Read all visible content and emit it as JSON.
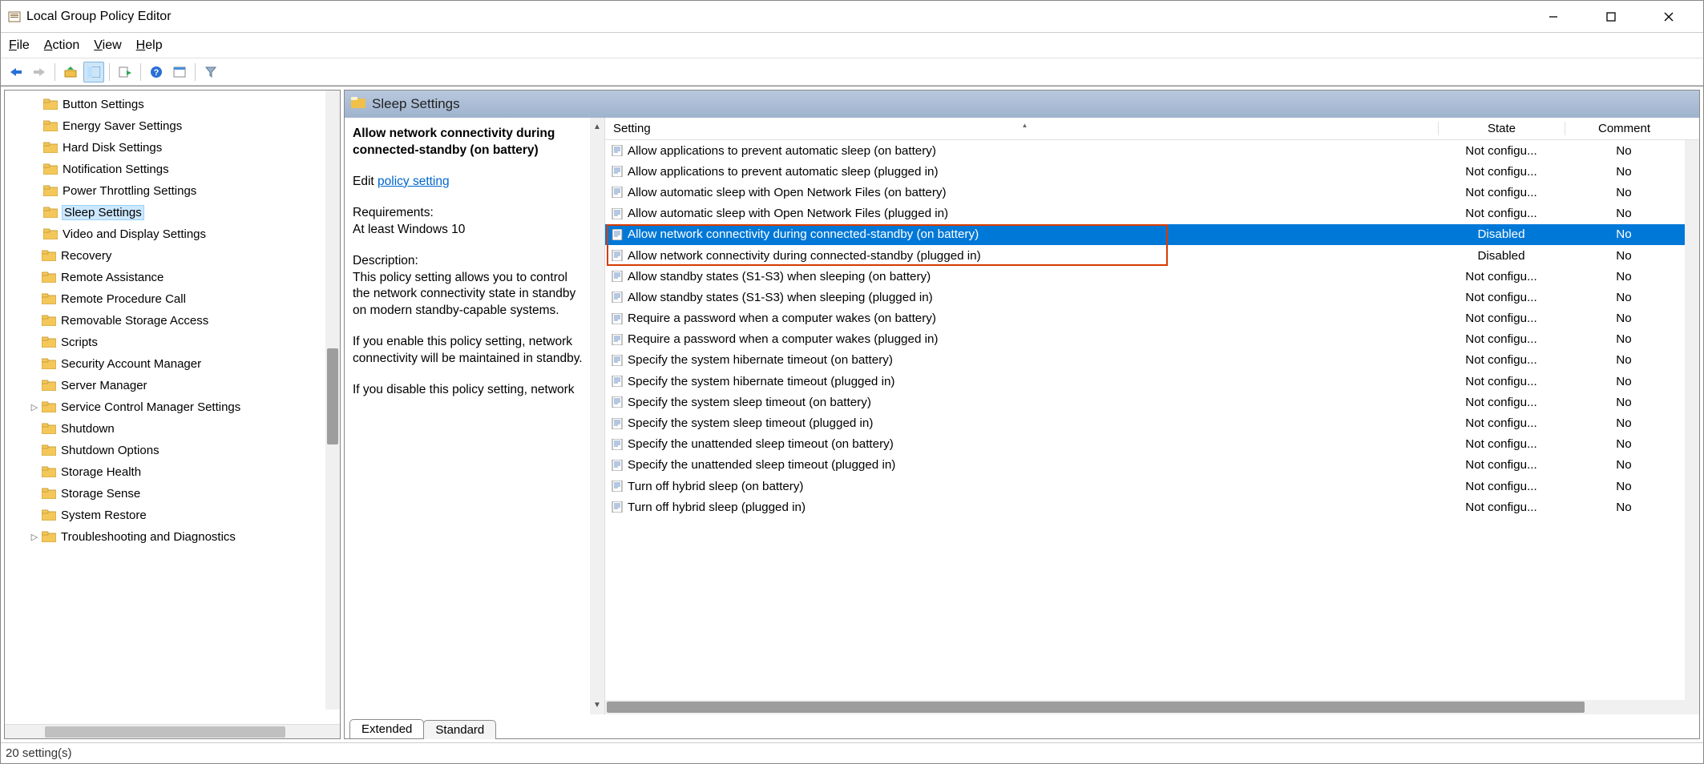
{
  "window": {
    "title": "Local Group Policy Editor"
  },
  "menubar": {
    "file": "File",
    "action": "Action",
    "view": "View",
    "help": "Help"
  },
  "tree": {
    "items": [
      {
        "label": "Button Settings",
        "indent": 1
      },
      {
        "label": "Energy Saver Settings",
        "indent": 1
      },
      {
        "label": "Hard Disk Settings",
        "indent": 1
      },
      {
        "label": "Notification Settings",
        "indent": 1
      },
      {
        "label": "Power Throttling Settings",
        "indent": 1
      },
      {
        "label": "Sleep Settings",
        "indent": 1,
        "selected": true
      },
      {
        "label": "Video and Display Settings",
        "indent": 1
      },
      {
        "label": "Recovery",
        "indent": 2
      },
      {
        "label": "Remote Assistance",
        "indent": 2
      },
      {
        "label": "Remote Procedure Call",
        "indent": 2
      },
      {
        "label": "Removable Storage Access",
        "indent": 2
      },
      {
        "label": "Scripts",
        "indent": 2
      },
      {
        "label": "Security Account Manager",
        "indent": 2
      },
      {
        "label": "Server Manager",
        "indent": 2
      },
      {
        "label": "Service Control Manager Settings",
        "indent": 2,
        "expandable": true
      },
      {
        "label": "Shutdown",
        "indent": 2
      },
      {
        "label": "Shutdown Options",
        "indent": 2
      },
      {
        "label": "Storage Health",
        "indent": 2
      },
      {
        "label": "Storage Sense",
        "indent": 2
      },
      {
        "label": "System Restore",
        "indent": 2
      },
      {
        "label": "Troubleshooting and Diagnostics",
        "indent": 2,
        "expandable": true
      }
    ]
  },
  "node_header": "Sleep Settings",
  "desc": {
    "title": "Allow network connectivity during connected-standby (on battery)",
    "edit_prefix": "Edit ",
    "edit_link": "policy setting ",
    "req_label": "Requirements:",
    "req_val": "At least Windows 10",
    "desc_label": "Description:",
    "desc_p1": "This policy setting allows you to control the network connectivity state in standby on modern standby-capable systems.",
    "desc_p2": "If you enable this policy setting, network connectivity will be maintained in standby.",
    "desc_p3": "If you disable this policy setting, network"
  },
  "columns": {
    "setting": "Setting",
    "state": "State",
    "comment": "Comment"
  },
  "rows": [
    {
      "s": "Allow applications to prevent automatic sleep (on battery)",
      "st": "Not configu...",
      "c": "No"
    },
    {
      "s": "Allow applications to prevent automatic sleep (plugged in)",
      "st": "Not configu...",
      "c": "No"
    },
    {
      "s": "Allow automatic sleep with Open Network Files (on battery)",
      "st": "Not configu...",
      "c": "No"
    },
    {
      "s": "Allow automatic sleep with Open Network Files (plugged in)",
      "st": "Not configu...",
      "c": "No"
    },
    {
      "s": "Allow network connectivity during connected-standby (on battery)",
      "st": "Disabled",
      "c": "No",
      "selected": true,
      "hl": true
    },
    {
      "s": "Allow network connectivity during connected-standby (plugged in)",
      "st": "Disabled",
      "c": "No",
      "hl": true
    },
    {
      "s": "Allow standby states (S1-S3) when sleeping (on battery)",
      "st": "Not configu...",
      "c": "No"
    },
    {
      "s": "Allow standby states (S1-S3) when sleeping (plugged in)",
      "st": "Not configu...",
      "c": "No"
    },
    {
      "s": "Require a password when a computer wakes (on battery)",
      "st": "Not configu...",
      "c": "No"
    },
    {
      "s": "Require a password when a computer wakes (plugged in)",
      "st": "Not configu...",
      "c": "No"
    },
    {
      "s": "Specify the system hibernate timeout (on battery)",
      "st": "Not configu...",
      "c": "No"
    },
    {
      "s": "Specify the system hibernate timeout (plugged in)",
      "st": "Not configu...",
      "c": "No"
    },
    {
      "s": "Specify the system sleep timeout (on battery)",
      "st": "Not configu...",
      "c": "No"
    },
    {
      "s": "Specify the system sleep timeout (plugged in)",
      "st": "Not configu...",
      "c": "No"
    },
    {
      "s": "Specify the unattended sleep timeout (on battery)",
      "st": "Not configu...",
      "c": "No"
    },
    {
      "s": "Specify the unattended sleep timeout (plugged in)",
      "st": "Not configu...",
      "c": "No"
    },
    {
      "s": "Turn off hybrid sleep (on battery)",
      "st": "Not configu...",
      "c": "No"
    },
    {
      "s": "Turn off hybrid sleep (plugged in)",
      "st": "Not configu...",
      "c": "No"
    }
  ],
  "tabs": {
    "extended": "Extended",
    "standard": "Standard"
  },
  "status": "20 setting(s)"
}
